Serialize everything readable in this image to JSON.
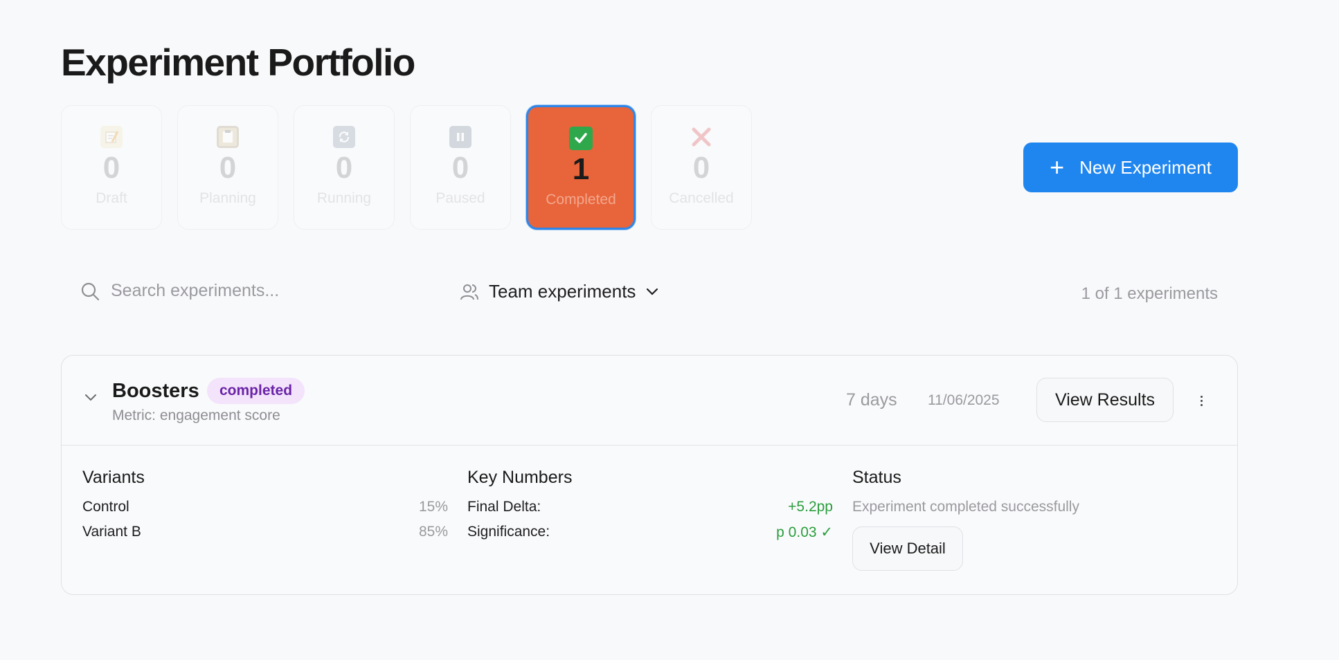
{
  "page": {
    "title": "Experiment Portfolio"
  },
  "status_cards": [
    {
      "label": "Draft",
      "count": "0",
      "icon": "memo-icon"
    },
    {
      "label": "Planning",
      "count": "0",
      "icon": "clipboard-icon"
    },
    {
      "label": "Running",
      "count": "0",
      "icon": "refresh-icon"
    },
    {
      "label": "Paused",
      "count": "0",
      "icon": "pause-icon"
    },
    {
      "label": "Completed",
      "count": "1",
      "icon": "check-icon",
      "active": true
    },
    {
      "label": "Cancelled",
      "count": "0",
      "icon": "cross-icon"
    }
  ],
  "actions": {
    "new_experiment": "New Experiment"
  },
  "toolbar": {
    "search_placeholder": "Search experiments...",
    "team_filter": "Team experiments",
    "result_count": "1 of 1 experiments"
  },
  "experiment": {
    "name": "Boosters",
    "status": "completed",
    "metric": "Metric: engagement score",
    "duration": "7 days",
    "date": "11/06/2025",
    "view_results": "View Results",
    "variants_title": "Variants",
    "variants": [
      {
        "name": "Control",
        "split": "15%"
      },
      {
        "name": "Variant B",
        "split": "85%"
      }
    ],
    "key_numbers_title": "Key Numbers",
    "key_numbers": [
      {
        "label": "Final Delta:",
        "value": "+5.2pp"
      },
      {
        "label": "Significance:",
        "value": "p 0.03 ✓"
      }
    ],
    "status_title": "Status",
    "status_text": "Experiment completed successfully",
    "view_detail": "View Detail"
  },
  "colors": {
    "accent": "#1f86ef",
    "completed_card": "#e8643a",
    "badge_bg": "#f3e3fb",
    "badge_text": "#6a23a7",
    "positive": "#2a9d3c"
  }
}
